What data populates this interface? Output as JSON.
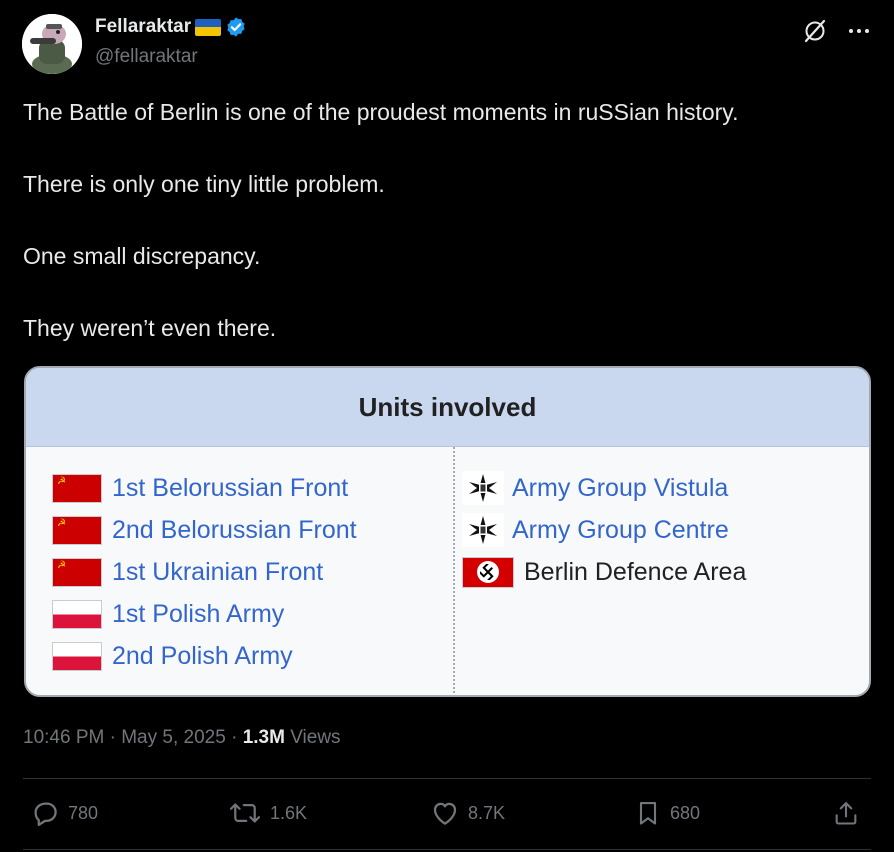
{
  "author": {
    "name": "Fellaraktar",
    "handle": "@fellaraktar",
    "verified": true,
    "flag_emoji": "ukraine-flag"
  },
  "tweet": {
    "paragraphs": [
      "The Battle of Berlin is one of the proudest moments in ruSSian history.",
      "There is only one tiny little problem.",
      "One small discrepancy.",
      "They weren’t even there."
    ]
  },
  "card": {
    "title": "Units involved",
    "left_units": [
      {
        "label": "1st Belorussian Front",
        "flag": "soviet"
      },
      {
        "label": "2nd Belorussian Front",
        "flag": "soviet"
      },
      {
        "label": "1st Ukrainian Front",
        "flag": "soviet"
      },
      {
        "label": "1st Polish Army",
        "flag": "poland"
      },
      {
        "label": "2nd Polish Army",
        "flag": "poland"
      }
    ],
    "right_units": [
      {
        "label": "Army Group Vistula",
        "flag": "iron-cross",
        "link": true
      },
      {
        "label": "Army Group Centre",
        "flag": "iron-cross",
        "link": true
      },
      {
        "label": "Berlin Defence Area",
        "flag": "nazi",
        "link": false
      }
    ]
  },
  "meta": {
    "time": "10:46 PM",
    "date": "May 5, 2025",
    "views_count": "1.3M",
    "views_label": "Views",
    "separator": "·"
  },
  "actions": {
    "replies": "780",
    "reposts": "1.6K",
    "likes": "8.7K",
    "bookmarks": "680"
  },
  "colors": {
    "background": "#000000",
    "text": "#e7e9ea",
    "muted": "#71767b",
    "link": "#3366cc",
    "verified": "#1d9bf0"
  }
}
